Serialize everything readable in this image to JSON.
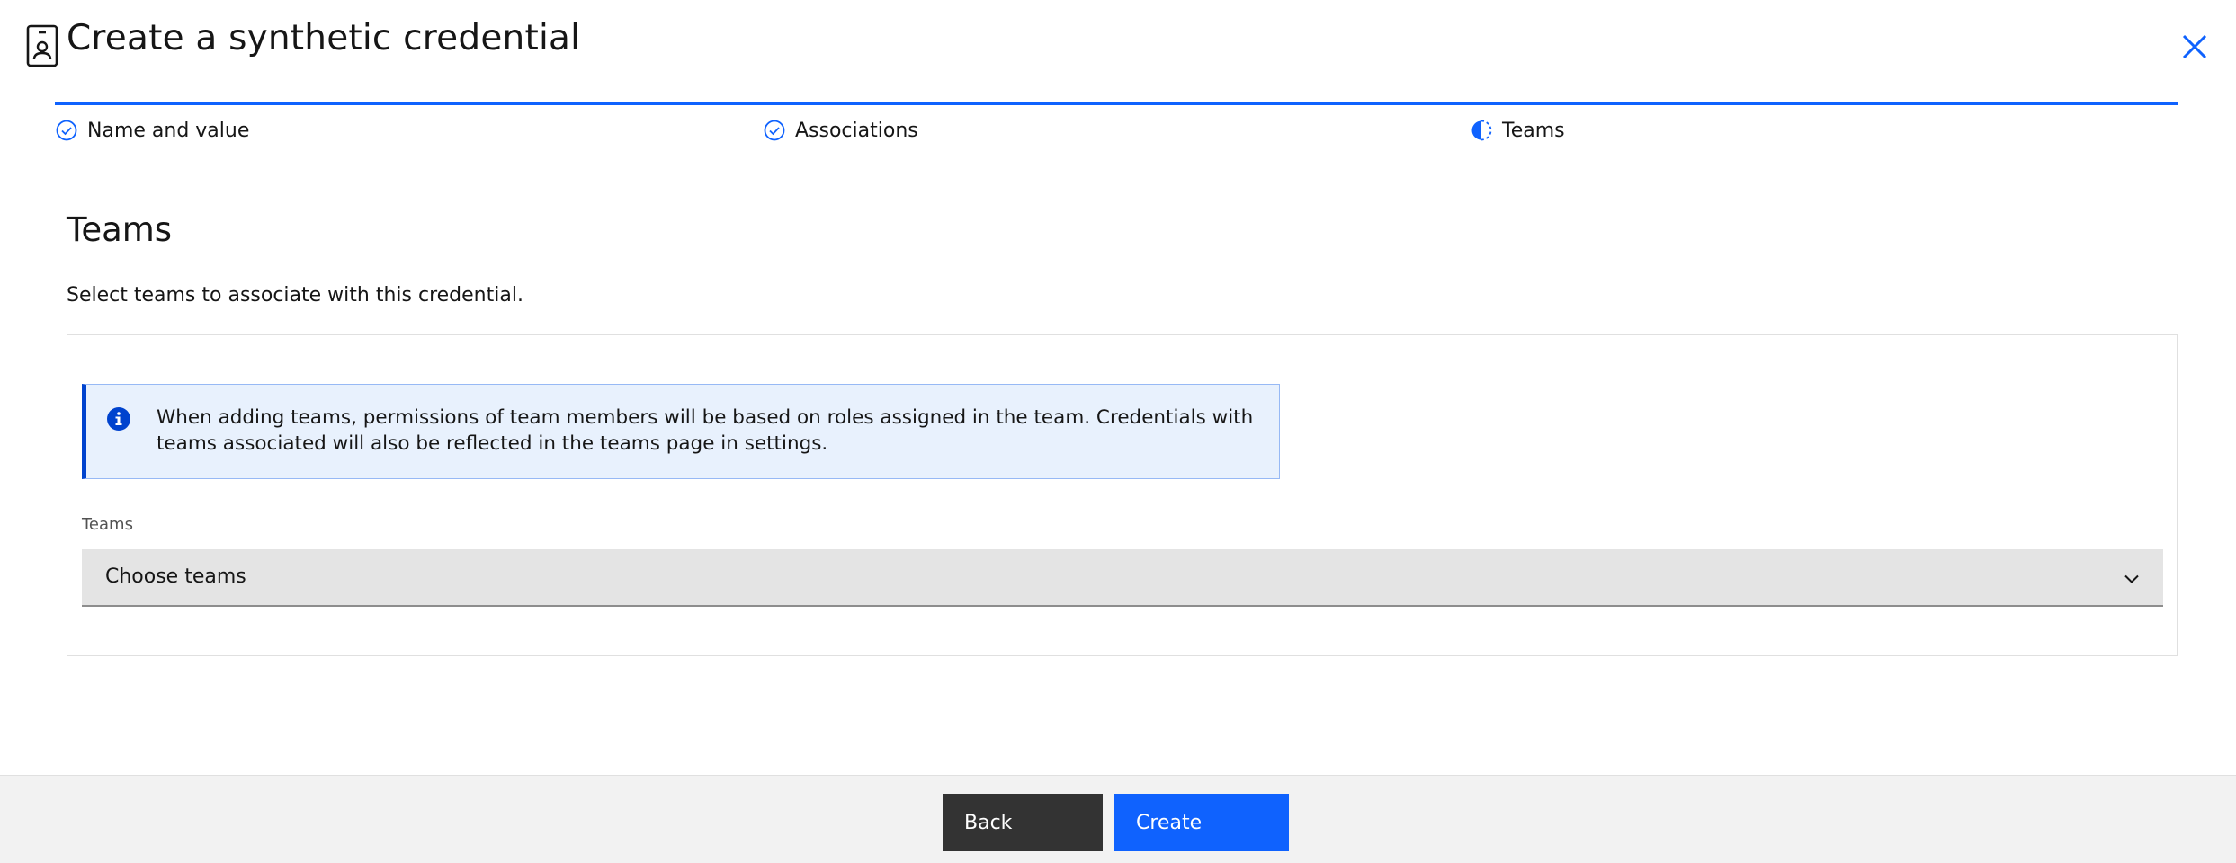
{
  "header": {
    "title": "Create a synthetic credential",
    "icon": "credential-badge-icon",
    "close_icon": "close-icon"
  },
  "progress": {
    "steps": [
      {
        "label": "Name and value",
        "status": "complete",
        "icon": "checkmark-circle-icon"
      },
      {
        "label": "Associations",
        "status": "complete",
        "icon": "checkmark-circle-icon"
      },
      {
        "label": "Teams",
        "status": "current",
        "icon": "half-circle-icon"
      }
    ]
  },
  "main": {
    "title": "Teams",
    "description": "Select teams to associate with this credential.",
    "notice": {
      "icon": "info-icon",
      "text": "When adding teams, permissions of team members will be based on roles assigned in the team. Credentials with teams associated will also be reflected in the teams page in settings."
    },
    "teams_field": {
      "label": "Teams",
      "placeholder": "Choose teams",
      "icon": "chevron-down-icon"
    }
  },
  "footer": {
    "back_label": "Back",
    "create_label": "Create"
  },
  "colors": {
    "accent": "#0f62fe",
    "notice_border": "#0043ce",
    "notice_bg": "#e8f1fd",
    "back_button": "#333333",
    "footer_bg": "#f2f2f2"
  }
}
